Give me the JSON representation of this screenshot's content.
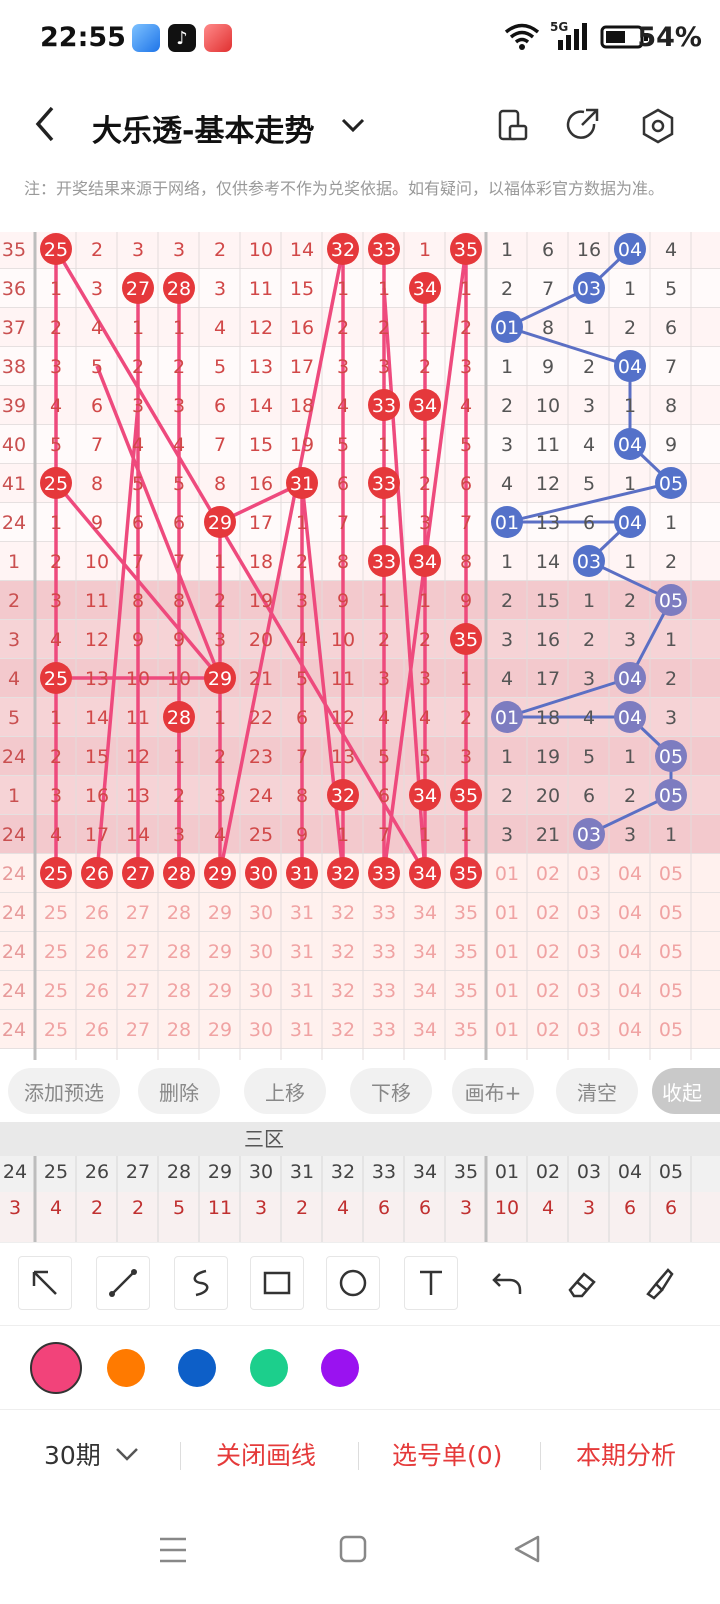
{
  "status_bar": {
    "time": "22:55",
    "network": "5G",
    "battery": "54%"
  },
  "header": {
    "title": "大乐透-基本走势"
  },
  "note": "注：开奖结果来源于网络，仅供参考不作为兑奖依据。如有疑问，以福体彩官方数据为准。",
  "grid": {
    "row_labels": [
      "35",
      "36",
      "37",
      "38",
      "39",
      "40",
      "41",
      "24",
      "1",
      "2",
      "3",
      "4",
      "5",
      "24",
      "1",
      "24",
      "24",
      "24",
      "24",
      "24",
      "24"
    ],
    "front_rows": [
      [
        "25",
        "2",
        "3",
        "3",
        "2",
        "10",
        "14",
        "32",
        "33",
        "1",
        "35"
      ],
      [
        "1",
        "3",
        "27",
        "28",
        "3",
        "11",
        "15",
        "1",
        "1",
        "34",
        "1"
      ],
      [
        "2",
        "4",
        "1",
        "1",
        "4",
        "12",
        "16",
        "2",
        "2",
        "1",
        "2"
      ],
      [
        "3",
        "5",
        "2",
        "2",
        "5",
        "13",
        "17",
        "3",
        "3",
        "2",
        "3"
      ],
      [
        "4",
        "6",
        "3",
        "3",
        "6",
        "14",
        "18",
        "4",
        "33",
        "34",
        "4"
      ],
      [
        "5",
        "7",
        "4",
        "4",
        "7",
        "15",
        "19",
        "5",
        "1",
        "1",
        "5"
      ],
      [
        "25",
        "8",
        "5",
        "5",
        "8",
        "16",
        "31",
        "6",
        "33",
        "2",
        "6"
      ],
      [
        "1",
        "9",
        "6",
        "6",
        "29",
        "17",
        "1",
        "7",
        "1",
        "3",
        "7"
      ],
      [
        "2",
        "10",
        "7",
        "7",
        "1",
        "18",
        "2",
        "8",
        "33",
        "34",
        "8"
      ],
      [
        "3",
        "11",
        "8",
        "8",
        "2",
        "19",
        "3",
        "9",
        "1",
        "1",
        "9"
      ],
      [
        "4",
        "12",
        "9",
        "9",
        "3",
        "20",
        "4",
        "10",
        "2",
        "2",
        "35"
      ],
      [
        "25",
        "13",
        "10",
        "10",
        "29",
        "21",
        "5",
        "11",
        "3",
        "3",
        "1"
      ],
      [
        "1",
        "14",
        "11",
        "28",
        "1",
        "22",
        "6",
        "12",
        "4",
        "4",
        "2"
      ],
      [
        "2",
        "15",
        "12",
        "1",
        "2",
        "23",
        "7",
        "13",
        "5",
        "5",
        "3"
      ],
      [
        "3",
        "16",
        "13",
        "2",
        "3",
        "24",
        "8",
        "32",
        "6",
        "34",
        "35"
      ],
      [
        "4",
        "17",
        "14",
        "3",
        "4",
        "25",
        "9",
        "1",
        "7",
        "1",
        "1"
      ],
      [
        "25",
        "26",
        "27",
        "28",
        "29",
        "30",
        "31",
        "32",
        "33",
        "34",
        "35"
      ],
      [
        "25",
        "26",
        "27",
        "28",
        "29",
        "30",
        "31",
        "32",
        "33",
        "34",
        "35"
      ],
      [
        "25",
        "26",
        "27",
        "28",
        "29",
        "30",
        "31",
        "32",
        "33",
        "34",
        "35"
      ],
      [
        "25",
        "26",
        "27",
        "28",
        "29",
        "30",
        "31",
        "32",
        "33",
        "34",
        "35"
      ],
      [
        "25",
        "26",
        "27",
        "28",
        "29",
        "30",
        "31",
        "32",
        "33",
        "34",
        "35"
      ]
    ],
    "back_rows": [
      [
        "1",
        "6",
        "16",
        "04",
        "4"
      ],
      [
        "2",
        "7",
        "03",
        "1",
        "5"
      ],
      [
        "01",
        "8",
        "1",
        "2",
        "6"
      ],
      [
        "1",
        "9",
        "2",
        "04",
        "7"
      ],
      [
        "2",
        "10",
        "3",
        "1",
        "8"
      ],
      [
        "3",
        "11",
        "4",
        "04",
        "9"
      ],
      [
        "4",
        "12",
        "5",
        "1",
        "05"
      ],
      [
        "01",
        "13",
        "6",
        "04",
        "1"
      ],
      [
        "1",
        "14",
        "03",
        "1",
        "2"
      ],
      [
        "2",
        "15",
        "1",
        "2",
        "05"
      ],
      [
        "3",
        "16",
        "2",
        "3",
        "1"
      ],
      [
        "4",
        "17",
        "3",
        "04",
        "2"
      ],
      [
        "01",
        "18",
        "4",
        "04",
        "3"
      ],
      [
        "1",
        "19",
        "5",
        "1",
        "05"
      ],
      [
        "2",
        "20",
        "6",
        "2",
        "05"
      ],
      [
        "3",
        "21",
        "03",
        "3",
        "1"
      ],
      [
        "01",
        "02",
        "03",
        "04",
        "05"
      ],
      [
        "01",
        "02",
        "03",
        "04",
        "05"
      ],
      [
        "01",
        "02",
        "03",
        "04",
        "05"
      ],
      [
        "01",
        "02",
        "03",
        "04",
        "05"
      ],
      [
        "01",
        "02",
        "03",
        "04",
        "05"
      ]
    ]
  },
  "toolbar": {
    "add_preselect": "添加预选",
    "delete": "删除",
    "move_up": "上移",
    "move_down": "下移",
    "canvas_plus": "画布+",
    "clear": "清空",
    "collapse": "收起"
  },
  "subgrid": {
    "zone_label": "三区",
    "front_headers": [
      "24",
      "25",
      "26",
      "27",
      "28",
      "29",
      "30",
      "31",
      "32",
      "33",
      "34",
      "35"
    ],
    "back_headers": [
      "01",
      "02",
      "03",
      "04",
      "05"
    ],
    "front_counts": [
      "3",
      "4",
      "2",
      "2",
      "5",
      "11",
      "3",
      "2",
      "4",
      "6",
      "6",
      "3"
    ],
    "back_counts": [
      "10",
      "4",
      "3",
      "6",
      "6"
    ]
  },
  "drawing_tools": [
    "arrow-tool",
    "line-tool",
    "curve-tool",
    "rectangle-tool",
    "circle-tool",
    "text-tool",
    "undo-tool",
    "eraser-tool",
    "brush-tool"
  ],
  "palette": [
    "#f2437a",
    "#ff7a00",
    "#0d5fc8",
    "#1ccf8c",
    "#9a12f0"
  ],
  "bottom_bar": {
    "period": "30期",
    "close_drawing": "关闭画线",
    "selection": "选号单(0)",
    "analysis": "本期分析"
  }
}
